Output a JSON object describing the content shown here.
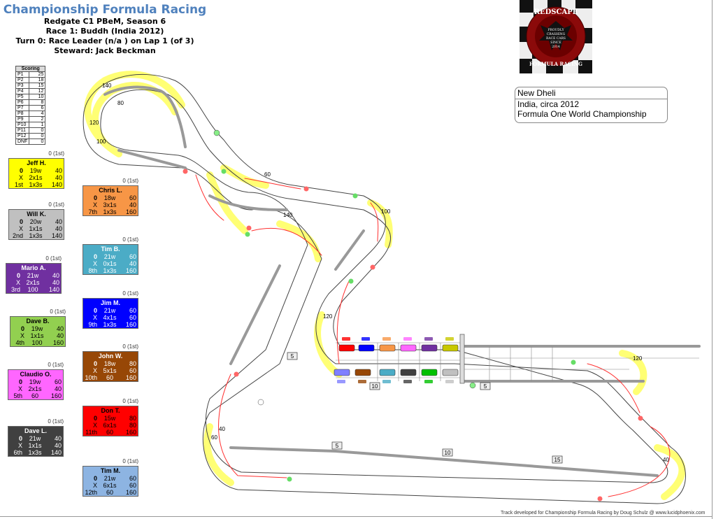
{
  "header": {
    "title": "Championship Formula Racing",
    "league": "Redgate C1 PBeM, Season 6",
    "race": "Race 1: Buddh (India 2012)",
    "turn": "Turn 0: Race Leader (n/a  ) on Lap 1 (of 3)",
    "steward": "Steward: Jack Beckman"
  },
  "scoring": {
    "header": "Scoring",
    "rows": [
      {
        "pos": "P1",
        "pts": "25"
      },
      {
        "pos": "P2",
        "pts": "18"
      },
      {
        "pos": "P3",
        "pts": "15"
      },
      {
        "pos": "P4",
        "pts": "12"
      },
      {
        "pos": "P5",
        "pts": "10"
      },
      {
        "pos": "P6",
        "pts": "8"
      },
      {
        "pos": "P7",
        "pts": "6"
      },
      {
        "pos": "P8",
        "pts": "4"
      },
      {
        "pos": "P9",
        "pts": "2"
      },
      {
        "pos": "P10",
        "pts": "1"
      },
      {
        "pos": "P11",
        "pts": "0"
      },
      {
        "pos": "P12",
        "pts": "0"
      },
      {
        "pos": "DNF",
        "pts": "0"
      }
    ]
  },
  "drivers": [
    {
      "name": "Jeff H.",
      "above": "0 (1st)",
      "r1": [
        "0",
        "19w",
        "40"
      ],
      "r2": [
        "X",
        "2x1s",
        "40"
      ],
      "r3": [
        "1st",
        "1x3s",
        "140"
      ],
      "bg": "#ffff00",
      "fg": "#000000"
    },
    {
      "name": "Chris L.",
      "above": "0 (1st)",
      "r1": [
        "0",
        "18w",
        "60"
      ],
      "r2": [
        "X",
        "3x1s",
        "40"
      ],
      "r3": [
        "7th",
        "1x3s",
        "160"
      ],
      "bg": "#f79646",
      "fg": "#000000"
    },
    {
      "name": "Will K.",
      "above": "0 (1st)",
      "r1": [
        "0",
        "20w",
        "40"
      ],
      "r2": [
        "X",
        "1x1s",
        "40"
      ],
      "r3": [
        "2nd",
        "1x3s",
        "140"
      ],
      "bg": "#c0c0c0",
      "fg": "#000000"
    },
    {
      "name": "Tim B.",
      "above": "0 (1st)",
      "r1": [
        "0",
        "21w",
        "60"
      ],
      "r2": [
        "X",
        "0x1s",
        "40"
      ],
      "r3": [
        "8th",
        "1x3s",
        "160"
      ],
      "bg": "#4bacc6",
      "fg": "#ffffff"
    },
    {
      "name": "Mario A.",
      "above": "0 (1st)",
      "r1": [
        "0",
        "21w",
        "40"
      ],
      "r2": [
        "X",
        "2x1s",
        "40"
      ],
      "r3": [
        "3rd",
        "100",
        "140"
      ],
      "bg": "#7030a0",
      "fg": "#ffffff"
    },
    {
      "name": "Jim M.",
      "above": "0 (1st)",
      "r1": [
        "0",
        "21w",
        "60"
      ],
      "r2": [
        "X",
        "4x1s",
        "60"
      ],
      "r3": [
        "9th",
        "1x3s",
        "160"
      ],
      "bg": "#0000ff",
      "fg": "#ffffff"
    },
    {
      "name": "Dave B.",
      "above": "0 (1st)",
      "r1": [
        "0",
        "19w",
        "40"
      ],
      "r2": [
        "X",
        "1x1s",
        "40"
      ],
      "r3": [
        "4th",
        "100",
        "160"
      ],
      "bg": "#92d050",
      "fg": "#000000"
    },
    {
      "name": "John W.",
      "above": "0 (1st)",
      "r1": [
        "0",
        "18w",
        "80"
      ],
      "r2": [
        "X",
        "5x1s",
        "60"
      ],
      "r3": [
        "10th",
        "60",
        "160"
      ],
      "bg": "#974706",
      "fg": "#ffffff"
    },
    {
      "name": "Claudio O.",
      "above": "0 (1st)",
      "r1": [
        "0",
        "19w",
        "60"
      ],
      "r2": [
        "X",
        "2x1s",
        "40"
      ],
      "r3": [
        "5th",
        "60",
        "160"
      ],
      "bg": "#ff66ff",
      "fg": "#000000"
    },
    {
      "name": "Don T.",
      "above": "0 (1st)",
      "r1": [
        "0",
        "15w",
        "80"
      ],
      "r2": [
        "X",
        "6x1s",
        "80"
      ],
      "r3": [
        "11th",
        "60",
        "160"
      ],
      "bg": "#ff0000",
      "fg": "#000000"
    },
    {
      "name": "Dave L.",
      "above": "0 (1st)",
      "r1": [
        "0",
        "21w",
        "40"
      ],
      "r2": [
        "X",
        "1x1s",
        "40"
      ],
      "r3": [
        "6th",
        "1x3s",
        "140"
      ],
      "bg": "#404040",
      "fg": "#ffffff"
    },
    {
      "name": "Tim M.",
      "above": "0 (1st)",
      "r1": [
        "0",
        "21w",
        "60"
      ],
      "r2": [
        "X",
        "6x1s",
        "60"
      ],
      "r3": [
        "12th",
        "60",
        "160"
      ],
      "bg": "#8db4e2",
      "fg": "#000000"
    }
  ],
  "logo": {
    "top_text": "REDSCAPE",
    "bottom_text": "FORMULA RACING",
    "motto": [
      "PROUDLY",
      "CRASHING",
      "RACE CARS",
      "SINCE",
      "2014"
    ]
  },
  "info": {
    "city": "New Dheli",
    "country": "India, circa 2012",
    "series": "Formula One World Championship"
  },
  "track": {
    "distance_markers": [
      "5",
      "10",
      "15",
      "5",
      "10",
      "5"
    ],
    "corner_speeds": [
      "120",
      "100",
      "80",
      "140",
      "60",
      "40"
    ],
    "grid_car_colors": [
      "#ff0000",
      "#0000ff",
      "#f79646",
      "#ff66ff",
      "#7030a0",
      "#c8c800",
      "#8080ff",
      "#974706",
      "#4bacc6",
      "#404040",
      "#00c000",
      "#c0c0c0"
    ]
  },
  "footer": "Track developed for Championship Formula Racing by Doug Schulz @ www.lucidphoenix.com"
}
